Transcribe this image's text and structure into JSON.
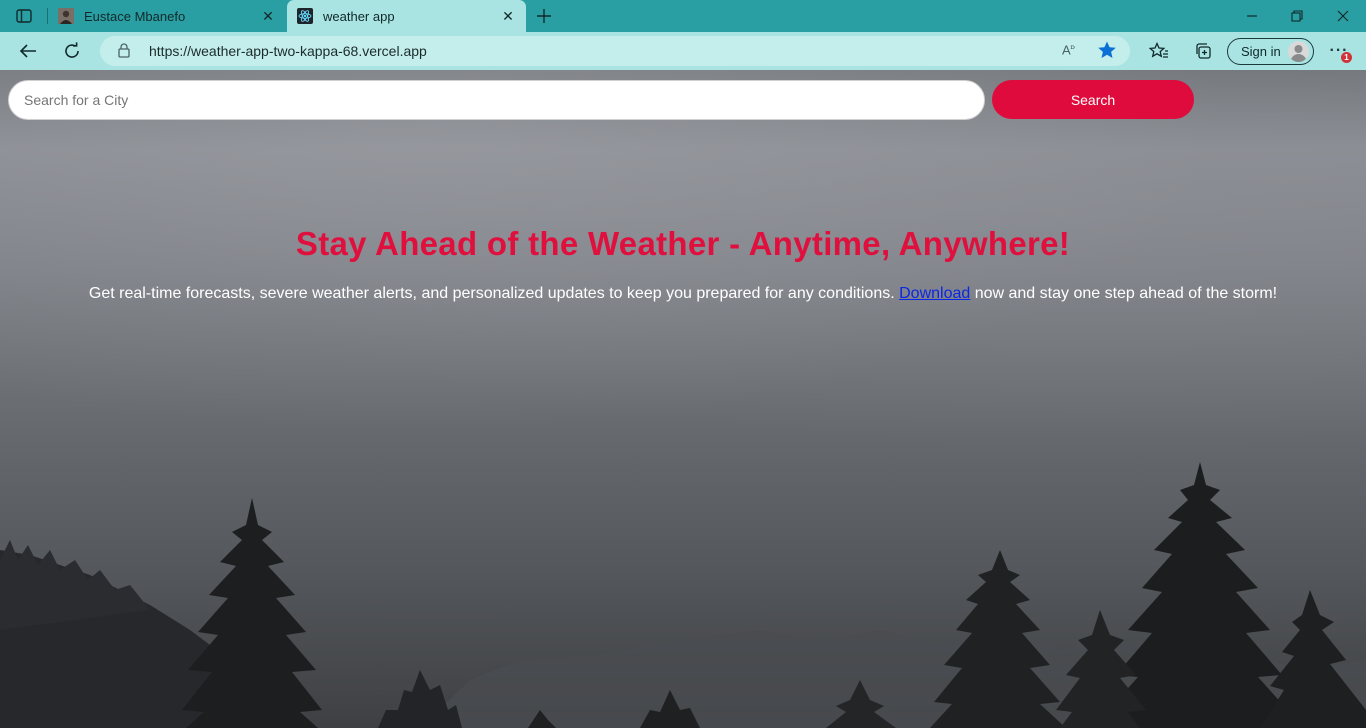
{
  "browser": {
    "tabs": [
      {
        "title": "Eustace Mbanefo",
        "active": false,
        "favicon": "profile-photo-icon"
      },
      {
        "title": "weather app",
        "active": true,
        "favicon": "react-icon"
      }
    ],
    "address_bar": {
      "url": "https://weather-app-two-kappa-68.vercel.app"
    },
    "sign_in_label": "Sign in",
    "notification_count": "1",
    "colors": {
      "tab_bar": "#2a9fa3",
      "toolbar": "#a9e4e2",
      "star": "#0b6fd6"
    }
  },
  "page": {
    "search": {
      "placeholder": "Search for a City",
      "value": "",
      "button_label": "Search"
    },
    "headline": "Stay Ahead of the Weather - Anytime, Anywhere!",
    "subtext_before": "Get real-time forecasts, severe weather alerts, and personalized updates to keep you prepared for any conditions. ",
    "link_label": "Download",
    "subtext_after": " now and stay one step ahead of the storm!",
    "colors": {
      "accent": "#df0b3c",
      "headline": "#e0103e",
      "link": "#0a26e6"
    }
  }
}
